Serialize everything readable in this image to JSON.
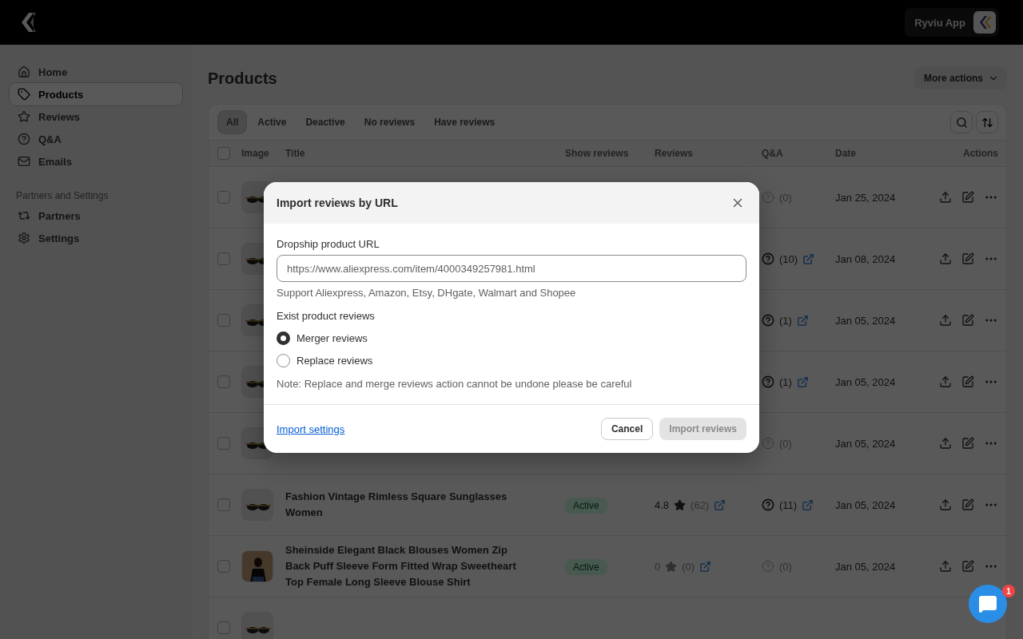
{
  "topbar": {
    "app_name": "Ryviu App"
  },
  "sidebar": {
    "items": [
      {
        "label": "Home",
        "selected": false
      },
      {
        "label": "Products",
        "selected": true
      },
      {
        "label": "Reviews",
        "selected": false
      },
      {
        "label": "Q&A",
        "selected": false
      },
      {
        "label": "Emails",
        "selected": false
      }
    ],
    "section_title": "Partners and Settings",
    "section_items": [
      {
        "label": "Partners",
        "selected": false
      },
      {
        "label": "Settings",
        "selected": false
      }
    ]
  },
  "page": {
    "title": "Products",
    "more_actions": "More actions"
  },
  "filters": [
    {
      "label": "All",
      "selected": true
    },
    {
      "label": "Active",
      "selected": false
    },
    {
      "label": "Deactive",
      "selected": false
    },
    {
      "label": "No reviews",
      "selected": false
    },
    {
      "label": "Have reviews",
      "selected": false
    }
  ],
  "table": {
    "columns": [
      "Image",
      "Title",
      "Show reviews",
      "Reviews",
      "Q&A",
      "Date",
      "Actions"
    ],
    "header_checked": false,
    "rows": [
      {
        "checked": false,
        "qa": {
          "count": "(0)",
          "active": false,
          "link": false
        },
        "date": "Jan 25, 2024"
      },
      {
        "checked": false,
        "qa": {
          "count": "(10)",
          "active": true,
          "link": true
        },
        "date": "Jan 08, 2024"
      },
      {
        "checked": false,
        "qa": {
          "count": "(1)",
          "active": true,
          "link": true
        },
        "date": "Jan 05, 2024"
      },
      {
        "checked": false,
        "qa": {
          "count": "(1)",
          "active": true,
          "link": true
        },
        "date": "Jan 05, 2024"
      },
      {
        "checked": false,
        "qa": {
          "count": "(0)",
          "active": false,
          "link": false
        },
        "date": "Jan 05, 2024"
      },
      {
        "checked": false,
        "title": "Fashion Vintage Rimless Square Sunglasses Women",
        "status": "Active",
        "reviews": {
          "rating": "4.8",
          "count": "(62)",
          "active": true,
          "link": true
        },
        "qa": {
          "count": "(11)",
          "active": true,
          "link": true
        },
        "date": "Jan 05, 2024"
      },
      {
        "checked": false,
        "title": "Sheinside Elegant Black Blouses Women Zip Back Puff Sleeve Form Fitted Wrap Sweetheart Top Female Long Sleeve Blouse Shirt",
        "status": "Active",
        "reviews": {
          "rating": "0",
          "count": "(0)",
          "active": false,
          "link": true
        },
        "qa": {
          "count": "(0)",
          "active": false,
          "link": false
        },
        "date": "Jan 05, 2024"
      },
      {
        "checked": false
      }
    ]
  },
  "modal": {
    "title": "Import reviews by URL",
    "url_label": "Dropship product URL",
    "url_value": "https://www.aliexpress.com/item/4000349257981.html",
    "url_help": "Support Aliexpress, Amazon, Etsy, DHgate, Walmart and Shopee",
    "reviews_label": "Exist product reviews",
    "options": [
      {
        "label": "Merger reviews",
        "selected": true
      },
      {
        "label": "Replace reviews",
        "selected": false
      }
    ],
    "note": "Note: Replace and merge reviews action cannot be undone please be careful",
    "settings_link": "Import settings",
    "cancel": "Cancel",
    "submit": {
      "label": "Import reviews",
      "disabled": true
    }
  },
  "chat": {
    "badge": "1"
  }
}
